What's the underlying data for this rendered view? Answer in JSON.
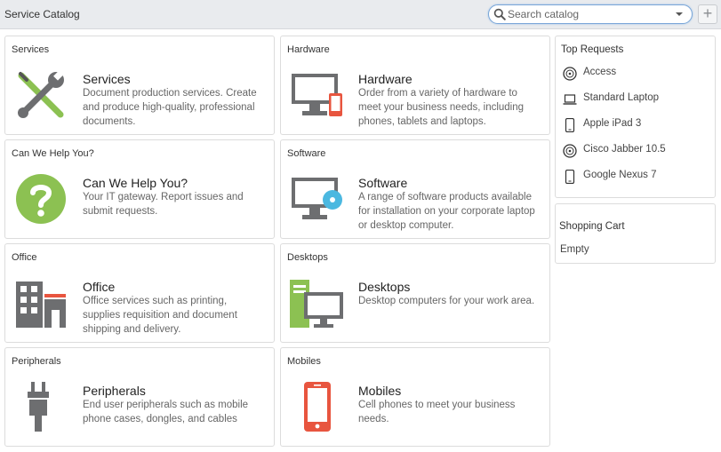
{
  "header": {
    "title": "Service Catalog",
    "search_placeholder": "Search catalog",
    "add_label": "+"
  },
  "categories": [
    {
      "header": "Services",
      "title": "Services",
      "description": "Document production services. Create and produce high-quality, professional documents.",
      "icon": "wrench-screwdriver-icon"
    },
    {
      "header": "Hardware",
      "title": "Hardware",
      "description": "Order from a variety of hardware to meet your business needs, including phones, tablets and laptops.",
      "icon": "monitor-phone-icon"
    },
    {
      "header": "Can We Help You?",
      "title": "Can We Help You?",
      "description": "Your IT gateway. Report issues and submit requests.",
      "icon": "question-icon"
    },
    {
      "header": "Software",
      "title": "Software",
      "description": "A range of software products available for installation on your corporate laptop or desktop computer.",
      "icon": "monitor-disc-icon"
    },
    {
      "header": "Office",
      "title": "Office",
      "description": "Office services such as printing, supplies requisition and document shipping and delivery.",
      "icon": "building-icon"
    },
    {
      "header": "Desktops",
      "title": "Desktops",
      "description": "Desktop computers for your work area.",
      "icon": "desktop-computer-icon"
    },
    {
      "header": "Peripherals",
      "title": "Peripherals",
      "description": "End user peripherals such as mobile phone cases, dongles, and cables",
      "icon": "plug-icon"
    },
    {
      "header": "Mobiles",
      "title": "Mobiles",
      "description": "Cell phones to meet your business needs.",
      "icon": "mobile-phone-icon"
    }
  ],
  "top_requests": {
    "header": "Top Requests",
    "items": [
      {
        "label": "Access",
        "icon": "disc-icon"
      },
      {
        "label": "Standard Laptop",
        "icon": "laptop-icon"
      },
      {
        "label": "Apple iPad 3",
        "icon": "phone-icon"
      },
      {
        "label": "Cisco Jabber 10.5",
        "icon": "disc-icon"
      },
      {
        "label": "Google Nexus 7",
        "icon": "phone-icon"
      }
    ]
  },
  "shopping_cart": {
    "header": "Shopping Cart",
    "status": "Empty"
  },
  "colors": {
    "icon_gray": "#6d6e70",
    "green": "#8cc152",
    "red": "#e8553f",
    "blue": "#4bb8e0",
    "search_border": "#7aa6d8"
  }
}
